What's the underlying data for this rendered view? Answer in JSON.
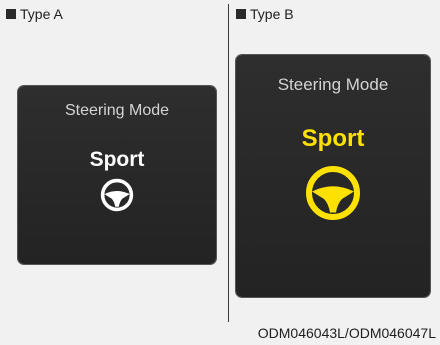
{
  "type_a": {
    "label": "Type A",
    "title": "Steering Mode",
    "mode": "Sport",
    "mode_color": "#ffffff",
    "icon": "steering-wheel-icon"
  },
  "type_b": {
    "label": "Type B",
    "title": "Steering Mode",
    "mode": "Sport",
    "mode_color": "#ffe100",
    "icon": "steering-wheel-icon"
  },
  "caption": "ODM046043L/ODM046047L"
}
